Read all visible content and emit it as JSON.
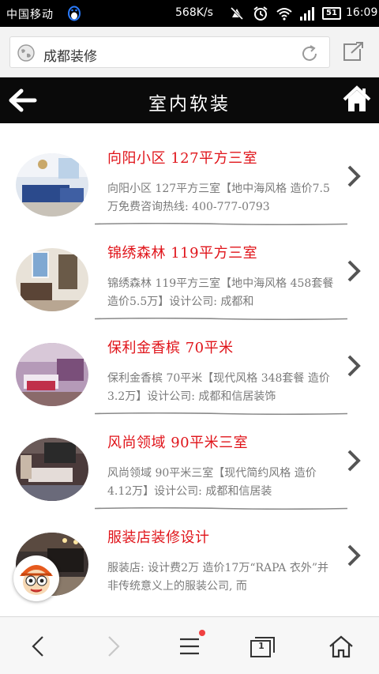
{
  "status_bar": {
    "carrier": "中国移动",
    "speed": "568K/s",
    "battery": "51",
    "time": "16:09"
  },
  "browser": {
    "url_text": "成都装修"
  },
  "header": {
    "title": "室内软装"
  },
  "list": [
    {
      "title": "向阳小区 127平方三室",
      "desc": "向阳小区 127平方三室【地中海风格 造价7.5万免费咨询热线: 400-777-0793"
    },
    {
      "title": "锦绣森林 119平方三室",
      "desc": "锦绣森林 119平方三室【地中海风格 458套餐 造价5.5万】设计公司: 成都和"
    },
    {
      "title": "保利金香槟 70平米",
      "desc": "保利金香槟 70平米【现代风格 348套餐 造价3.2万】设计公司: 成都和信居装饰"
    },
    {
      "title": "风尚领域 90平米三室",
      "desc": "风尚领域 90平米三室【现代简约风格 造价4.12万】设计公司: 成都和信居装"
    },
    {
      "title": "服装店装修设计",
      "desc": "服装店: 设计费2万 造价17万“RAPA 衣外”并非传统意义上的服装公司, 而"
    }
  ],
  "bottom_nav": {
    "tab_count": "1"
  },
  "colors": {
    "accent_red": "#e0141a",
    "title_bar": "#0a0a0a",
    "desc_gray": "#7a7a7a"
  },
  "icons": [
    "qq-penguin-icon",
    "mute-icon",
    "alarm-icon",
    "wifi-icon",
    "signal-icon",
    "globe-icon",
    "refresh-icon",
    "share-icon",
    "back-arrow-icon",
    "home-icon",
    "chevron-right-icon",
    "mascot-avatar-icon",
    "nav-back-icon",
    "nav-forward-icon",
    "menu-icon",
    "tabs-icon",
    "nav-home-icon"
  ]
}
